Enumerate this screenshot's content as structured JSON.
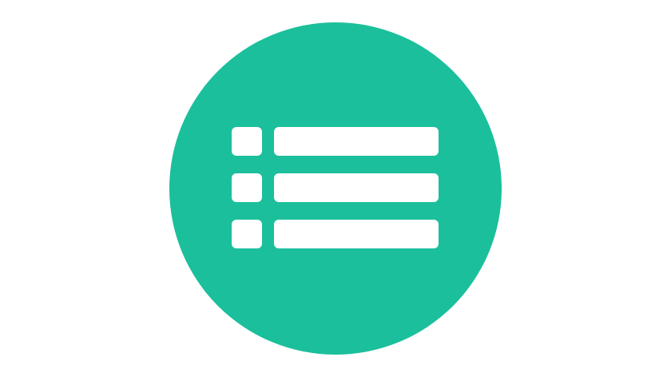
{
  "icon": {
    "name": "list-icon",
    "background_color": "#1bbf9c",
    "foreground_color": "#ffffff",
    "rows": 3
  }
}
